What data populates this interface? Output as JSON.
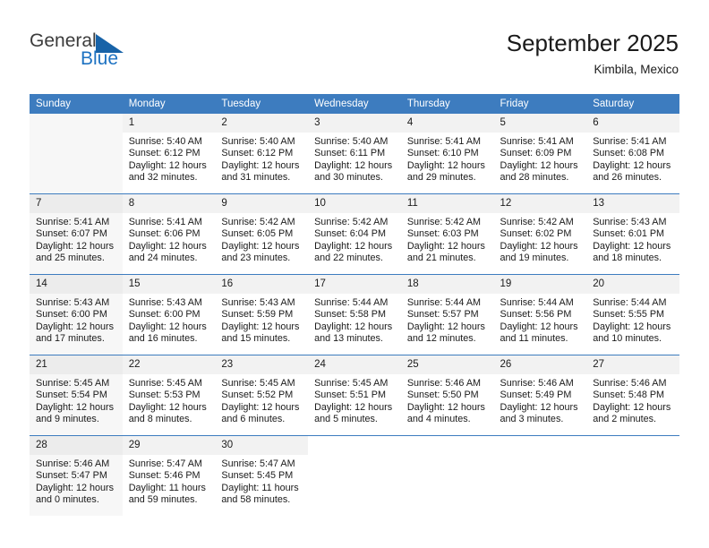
{
  "logo": {
    "word1": "General",
    "word2": "Blue",
    "triangle_color": "#1863a8",
    "blue_color": "#1d72c2"
  },
  "header": {
    "title": "September 2025",
    "location": "Kimbila, Mexico",
    "header_bg": "#3d7cbf",
    "header_text_color": "#ffffff"
  },
  "weekday_headers": [
    "Sunday",
    "Monday",
    "Tuesday",
    "Wednesday",
    "Thursday",
    "Friday",
    "Saturday"
  ],
  "weeks": [
    [
      {
        "day": "",
        "sunrise": "",
        "sunset": "",
        "daylight1": "",
        "daylight2": ""
      },
      {
        "day": "1",
        "sunrise": "Sunrise: 5:40 AM",
        "sunset": "Sunset: 6:12 PM",
        "daylight1": "Daylight: 12 hours",
        "daylight2": "and 32 minutes."
      },
      {
        "day": "2",
        "sunrise": "Sunrise: 5:40 AM",
        "sunset": "Sunset: 6:12 PM",
        "daylight1": "Daylight: 12 hours",
        "daylight2": "and 31 minutes."
      },
      {
        "day": "3",
        "sunrise": "Sunrise: 5:40 AM",
        "sunset": "Sunset: 6:11 PM",
        "daylight1": "Daylight: 12 hours",
        "daylight2": "and 30 minutes."
      },
      {
        "day": "4",
        "sunrise": "Sunrise: 5:41 AM",
        "sunset": "Sunset: 6:10 PM",
        "daylight1": "Daylight: 12 hours",
        "daylight2": "and 29 minutes."
      },
      {
        "day": "5",
        "sunrise": "Sunrise: 5:41 AM",
        "sunset": "Sunset: 6:09 PM",
        "daylight1": "Daylight: 12 hours",
        "daylight2": "and 28 minutes."
      },
      {
        "day": "6",
        "sunrise": "Sunrise: 5:41 AM",
        "sunset": "Sunset: 6:08 PM",
        "daylight1": "Daylight: 12 hours",
        "daylight2": "and 26 minutes."
      }
    ],
    [
      {
        "day": "7",
        "sunrise": "Sunrise: 5:41 AM",
        "sunset": "Sunset: 6:07 PM",
        "daylight1": "Daylight: 12 hours",
        "daylight2": "and 25 minutes."
      },
      {
        "day": "8",
        "sunrise": "Sunrise: 5:41 AM",
        "sunset": "Sunset: 6:06 PM",
        "daylight1": "Daylight: 12 hours",
        "daylight2": "and 24 minutes."
      },
      {
        "day": "9",
        "sunrise": "Sunrise: 5:42 AM",
        "sunset": "Sunset: 6:05 PM",
        "daylight1": "Daylight: 12 hours",
        "daylight2": "and 23 minutes."
      },
      {
        "day": "10",
        "sunrise": "Sunrise: 5:42 AM",
        "sunset": "Sunset: 6:04 PM",
        "daylight1": "Daylight: 12 hours",
        "daylight2": "and 22 minutes."
      },
      {
        "day": "11",
        "sunrise": "Sunrise: 5:42 AM",
        "sunset": "Sunset: 6:03 PM",
        "daylight1": "Daylight: 12 hours",
        "daylight2": "and 21 minutes."
      },
      {
        "day": "12",
        "sunrise": "Sunrise: 5:42 AM",
        "sunset": "Sunset: 6:02 PM",
        "daylight1": "Daylight: 12 hours",
        "daylight2": "and 19 minutes."
      },
      {
        "day": "13",
        "sunrise": "Sunrise: 5:43 AM",
        "sunset": "Sunset: 6:01 PM",
        "daylight1": "Daylight: 12 hours",
        "daylight2": "and 18 minutes."
      }
    ],
    [
      {
        "day": "14",
        "sunrise": "Sunrise: 5:43 AM",
        "sunset": "Sunset: 6:00 PM",
        "daylight1": "Daylight: 12 hours",
        "daylight2": "and 17 minutes."
      },
      {
        "day": "15",
        "sunrise": "Sunrise: 5:43 AM",
        "sunset": "Sunset: 6:00 PM",
        "daylight1": "Daylight: 12 hours",
        "daylight2": "and 16 minutes."
      },
      {
        "day": "16",
        "sunrise": "Sunrise: 5:43 AM",
        "sunset": "Sunset: 5:59 PM",
        "daylight1": "Daylight: 12 hours",
        "daylight2": "and 15 minutes."
      },
      {
        "day": "17",
        "sunrise": "Sunrise: 5:44 AM",
        "sunset": "Sunset: 5:58 PM",
        "daylight1": "Daylight: 12 hours",
        "daylight2": "and 13 minutes."
      },
      {
        "day": "18",
        "sunrise": "Sunrise: 5:44 AM",
        "sunset": "Sunset: 5:57 PM",
        "daylight1": "Daylight: 12 hours",
        "daylight2": "and 12 minutes."
      },
      {
        "day": "19",
        "sunrise": "Sunrise: 5:44 AM",
        "sunset": "Sunset: 5:56 PM",
        "daylight1": "Daylight: 12 hours",
        "daylight2": "and 11 minutes."
      },
      {
        "day": "20",
        "sunrise": "Sunrise: 5:44 AM",
        "sunset": "Sunset: 5:55 PM",
        "daylight1": "Daylight: 12 hours",
        "daylight2": "and 10 minutes."
      }
    ],
    [
      {
        "day": "21",
        "sunrise": "Sunrise: 5:45 AM",
        "sunset": "Sunset: 5:54 PM",
        "daylight1": "Daylight: 12 hours",
        "daylight2": "and 9 minutes."
      },
      {
        "day": "22",
        "sunrise": "Sunrise: 5:45 AM",
        "sunset": "Sunset: 5:53 PM",
        "daylight1": "Daylight: 12 hours",
        "daylight2": "and 8 minutes."
      },
      {
        "day": "23",
        "sunrise": "Sunrise: 5:45 AM",
        "sunset": "Sunset: 5:52 PM",
        "daylight1": "Daylight: 12 hours",
        "daylight2": "and 6 minutes."
      },
      {
        "day": "24",
        "sunrise": "Sunrise: 5:45 AM",
        "sunset": "Sunset: 5:51 PM",
        "daylight1": "Daylight: 12 hours",
        "daylight2": "and 5 minutes."
      },
      {
        "day": "25",
        "sunrise": "Sunrise: 5:46 AM",
        "sunset": "Sunset: 5:50 PM",
        "daylight1": "Daylight: 12 hours",
        "daylight2": "and 4 minutes."
      },
      {
        "day": "26",
        "sunrise": "Sunrise: 5:46 AM",
        "sunset": "Sunset: 5:49 PM",
        "daylight1": "Daylight: 12 hours",
        "daylight2": "and 3 minutes."
      },
      {
        "day": "27",
        "sunrise": "Sunrise: 5:46 AM",
        "sunset": "Sunset: 5:48 PM",
        "daylight1": "Daylight: 12 hours",
        "daylight2": "and 2 minutes."
      }
    ],
    [
      {
        "day": "28",
        "sunrise": "Sunrise: 5:46 AM",
        "sunset": "Sunset: 5:47 PM",
        "daylight1": "Daylight: 12 hours",
        "daylight2": "and 0 minutes."
      },
      {
        "day": "29",
        "sunrise": "Sunrise: 5:47 AM",
        "sunset": "Sunset: 5:46 PM",
        "daylight1": "Daylight: 11 hours",
        "daylight2": "and 59 minutes."
      },
      {
        "day": "30",
        "sunrise": "Sunrise: 5:47 AM",
        "sunset": "Sunset: 5:45 PM",
        "daylight1": "Daylight: 11 hours",
        "daylight2": "and 58 minutes."
      },
      {
        "day": "",
        "sunrise": "",
        "sunset": "",
        "daylight1": "",
        "daylight2": ""
      },
      {
        "day": "",
        "sunrise": "",
        "sunset": "",
        "daylight1": "",
        "daylight2": ""
      },
      {
        "day": "",
        "sunrise": "",
        "sunset": "",
        "daylight1": "",
        "daylight2": ""
      },
      {
        "day": "",
        "sunrise": "",
        "sunset": "",
        "daylight1": "",
        "daylight2": ""
      }
    ]
  ]
}
